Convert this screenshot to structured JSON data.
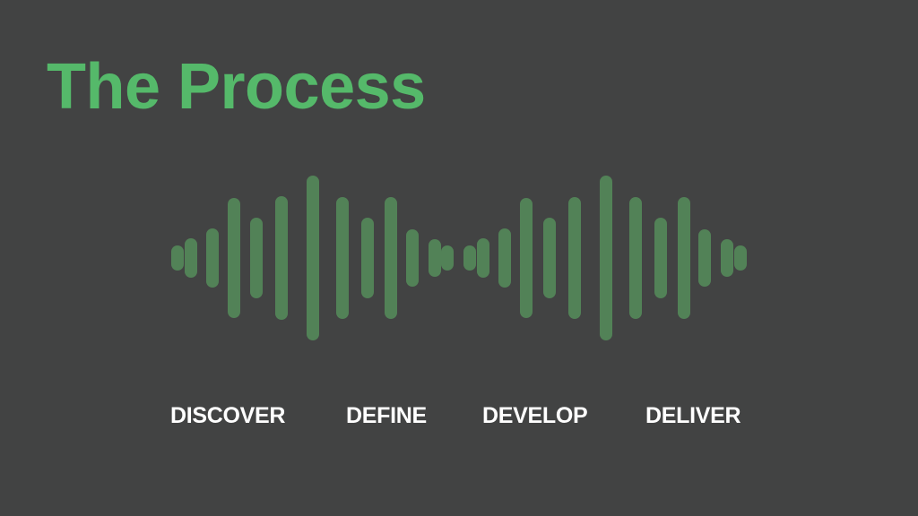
{
  "slide": {
    "title": "The Process",
    "stages": [
      "DISCOVER",
      "DEFINE",
      "DEVELOP",
      "DELIVER"
    ],
    "colors": {
      "background": "#424343",
      "title": "#55b96a",
      "bars": "#528257",
      "labels": "#ffffff"
    },
    "icons": [
      "sound-wave-icon"
    ]
  }
}
